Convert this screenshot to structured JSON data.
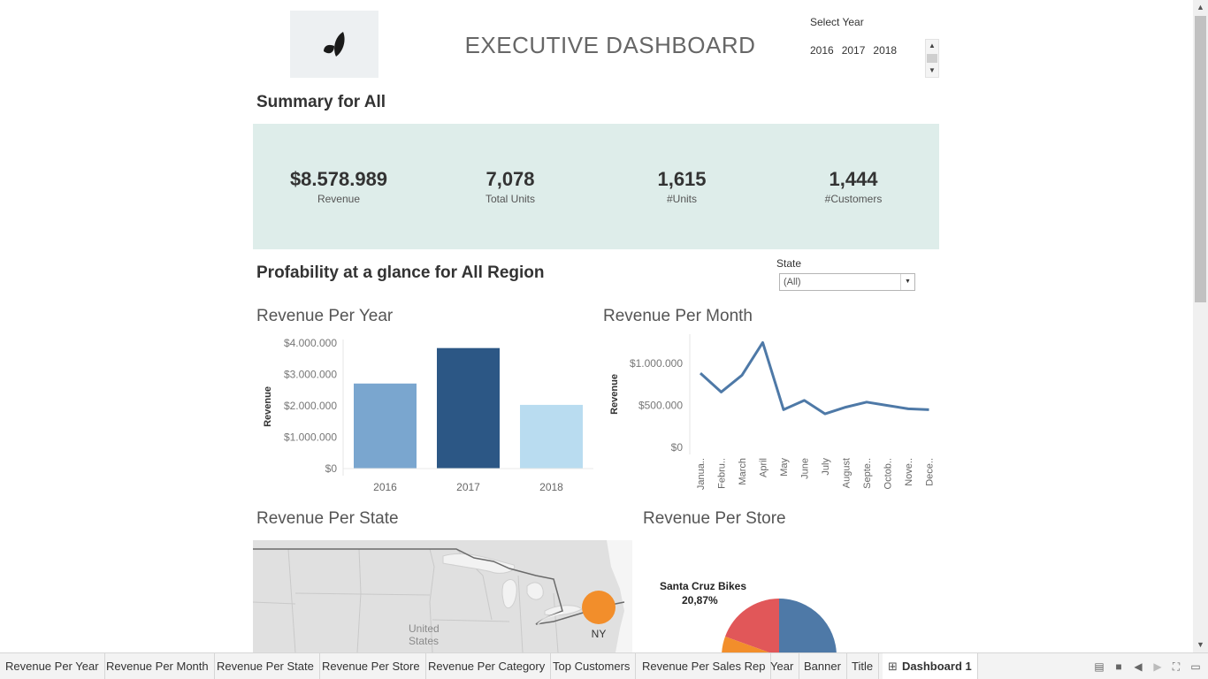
{
  "header": {
    "title": "EXECUTIVE DASHBOARD",
    "logo_icon": "leaf-logo-icon",
    "select_year_label": "Select Year",
    "years": [
      "2016",
      "2017",
      "2018"
    ]
  },
  "summary": {
    "title": "Summary for All",
    "kpis": [
      {
        "value": "$8.578.989",
        "label": "Revenue"
      },
      {
        "value": "7,078",
        "label": "Total Units"
      },
      {
        "value": "1,615",
        "label": "#Units"
      },
      {
        "value": "1,444",
        "label": "#Customers"
      }
    ]
  },
  "profitability": {
    "title": "Profability at a glance for All Region",
    "state_filter_label": "State",
    "state_filter_value": "(All)"
  },
  "colors": {
    "kpi_panel": "#deedea",
    "bar_2016": "#7aa6cf",
    "bar_2017": "#2c5785",
    "bar_2018": "#b9dcf0",
    "line": "#4e79a7",
    "map_marker": "#f28e2b",
    "pie_blue": "#4e79a7",
    "pie_red": "#e15759",
    "pie_orange": "#f28e2b"
  },
  "chart_data": [
    {
      "type": "bar",
      "title": "Revenue Per Year",
      "xlabel": "",
      "ylabel": "Revenue",
      "categories": [
        "2016",
        "2017",
        "2018"
      ],
      "values": [
        2710000,
        3840000,
        2030000
      ],
      "yticks": [
        0,
        1000000,
        2000000,
        3000000,
        4000000
      ],
      "ytick_labels": [
        "$0",
        "$1.000.000",
        "$2.000.000",
        "$3.000.000",
        "$4.000.000"
      ],
      "ylim": [
        0,
        4000000
      ],
      "grid": false
    },
    {
      "type": "line",
      "title": "Revenue Per Month",
      "xlabel": "",
      "ylabel": "Revenue",
      "categories": [
        "Janua..",
        "Febru..",
        "March",
        "April",
        "May",
        "June",
        "July",
        "August",
        "Septe..",
        "Octob..",
        "Nove..",
        "Dece.."
      ],
      "values": [
        885000,
        660000,
        860000,
        1250000,
        450000,
        560000,
        400000,
        480000,
        540000,
        500000,
        460000,
        450000
      ],
      "yticks": [
        0,
        500000,
        1000000
      ],
      "ytick_labels": [
        "$0",
        "$500.000",
        "$1.000.000"
      ],
      "ylim": [
        0,
        1350000
      ],
      "grid": false
    },
    {
      "type": "pie",
      "title": "Revenue Per Store",
      "slices": [
        {
          "name": "Santa Cruz Bikes",
          "label": "Santa Cruz Bikes",
          "pct_label": "20,87%",
          "value": 20.87
        }
      ]
    }
  ],
  "map": {
    "title": "Revenue Per State",
    "country_label": "United\nStates",
    "marker_label": "NY"
  },
  "tabs": [
    {
      "label": "Revenue Per Year",
      "active": false
    },
    {
      "label": "Revenue Per Month",
      "active": false
    },
    {
      "label": "Revenue Per State",
      "active": false
    },
    {
      "label": "Revenue Per Store",
      "active": false
    },
    {
      "label": "Revenue Per Category",
      "active": false
    },
    {
      "label": "Top Customers",
      "active": false
    },
    {
      "label": "Revenue Per Sales Rep",
      "active": false
    },
    {
      "label": "Year",
      "active": false
    },
    {
      "label": "Banner",
      "active": false
    },
    {
      "label": "Title",
      "active": false
    },
    {
      "label": "Dashboard 1",
      "active": true
    }
  ]
}
